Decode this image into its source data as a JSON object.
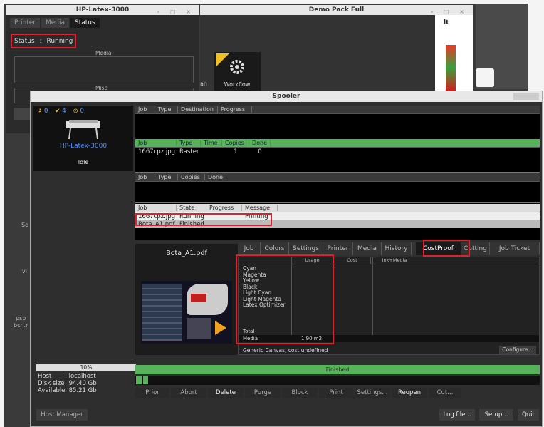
{
  "printer_window": {
    "title": "HP-Latex-3000",
    "tabs": [
      "Printer",
      "Media",
      "Status"
    ],
    "status_label": "Status",
    "status_sep": ":",
    "status_value": "Running",
    "media_label": "Media",
    "misc_label": "Misc"
  },
  "demo_window": {
    "title": "Demo Pack Full",
    "workflow_label": "Workflow",
    "partial_label": "an",
    "right_partial": "lt"
  },
  "background_text": {
    "left1": "Se",
    "left2": "vi",
    "left3": "psp",
    "left4": "bcn.r"
  },
  "spooler": {
    "title": "Spooler",
    "counts": {
      "waiting": "0",
      "done": "4",
      "error": "0"
    },
    "printer_name": "HP-Latex-3000",
    "printer_state": "Idle",
    "progress_label": "10%",
    "host_label": "Host",
    "host_value": "localhost",
    "disk_label": "Disk size",
    "disk_value": "94.40 Gb",
    "avail_label": "Available",
    "avail_value": "85.21 Gb",
    "host_manager": "Host Manager",
    "queue1": {
      "headers": [
        "Job",
        "Type",
        "Destination",
        "Progress"
      ]
    },
    "queue2": {
      "headers": [
        "Job",
        "Type",
        "Time",
        "Copies",
        "Done"
      ],
      "rows": [
        [
          "1667cpz.jpg",
          "Raster",
          "",
          "1",
          "0"
        ]
      ]
    },
    "queue3": {
      "headers": [
        "Job",
        "Type",
        "Copies",
        "Done"
      ]
    },
    "queue4": {
      "headers": [
        "Job",
        "State",
        "Progress",
        "Message"
      ],
      "rows": [
        [
          "1667cpz.jpg",
          "Running",
          "",
          "Printing"
        ],
        [
          "Bota_A1.pdf",
          "Finished",
          "",
          ""
        ]
      ]
    },
    "preview_filename": "Bota_A1.pdf",
    "tabs": [
      "Job",
      "Colors",
      "Settings",
      "Printer",
      "Media",
      "History",
      "CostProof",
      "Cutting",
      "Job Ticket"
    ],
    "cost_table": {
      "headers": [
        "",
        "Usage",
        "Cost",
        "Ink+Media"
      ],
      "inks": [
        "Cyan",
        "Magenta",
        "Yellow",
        "Black",
        "Light Cyan",
        "Light Magenta",
        "Latex Optimizer"
      ],
      "total_label": "Total",
      "media_label": "Media",
      "media_usage": "1.90 m2"
    },
    "canvas_note": "Generic Canvas, cost undefined",
    "configure": "Configure...",
    "finished_label": "Finished",
    "actions": [
      "Prior",
      "Abort",
      "Delete",
      "Purge",
      "Block",
      "Print",
      "Settings...",
      "Reopen",
      "Cut..."
    ],
    "footer": {
      "log": "Log file...",
      "setup": "Setup...",
      "quit": "Quit"
    }
  },
  "colors": {
    "accent_green": "#58b25c",
    "highlight_red": "#e0202a",
    "icon_yellow": "#f0c020"
  }
}
